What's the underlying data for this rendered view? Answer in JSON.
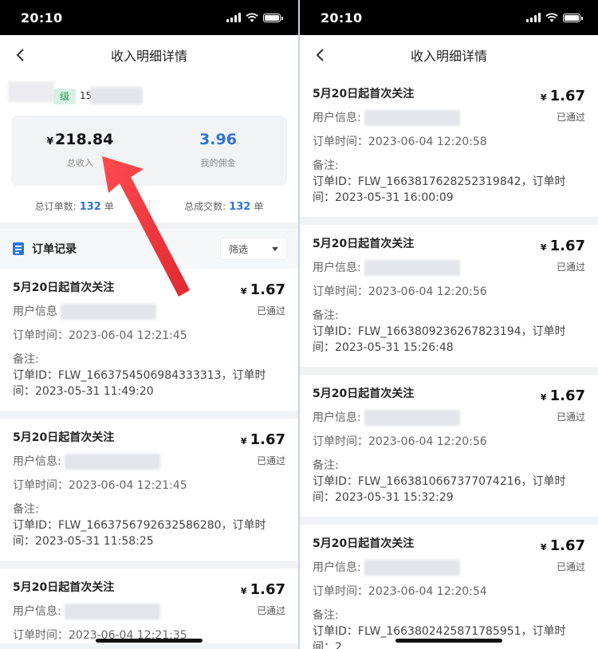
{
  "left": {
    "status_time": "20:10",
    "nav_title": "收入明细详情",
    "profile": {
      "level": "级",
      "uid_prefix": "15"
    },
    "summary": {
      "income_currency": "¥",
      "income_value": "218.84",
      "income_label": "总收入",
      "commission_value": "3.96",
      "commission_label": "我的佣金"
    },
    "counts": {
      "orders_label": "总订单数:",
      "orders_value": "132",
      "orders_unit": "单",
      "deals_label": "总成交数:",
      "deals_value": "132",
      "deals_unit": "单"
    },
    "section": {
      "title": "订单记录",
      "filter": "筛选"
    },
    "cards": [
      {
        "title": "5月20日起首次关注",
        "currency": "¥",
        "amount": "1.67",
        "status": "已通过",
        "user_label": "用户信息",
        "time": "订单时间：2023-06-04 12:21:45",
        "remark_label": "备注:",
        "remark": "订单ID：FLW_1663754506984333313，订单时间：2023-05-31 11:49:20"
      },
      {
        "title": "5月20日起首次关注",
        "currency": "¥",
        "amount": "1.67",
        "status": "已通过",
        "user_label": "用户信息:",
        "time": "订单时间：2023-06-04 12:21:45",
        "remark_label": "备注:",
        "remark": "订单ID：FLW_1663756792632586280，订单时间：2023-05-31 11:58:25"
      },
      {
        "title": "5月20日起首次关注",
        "currency": "¥",
        "amount": "1.67",
        "status": "已通过",
        "user_label": "用户信息:",
        "time": "订单时间：2023-06-04 12:21:35",
        "remark_label": "",
        "remark": ""
      }
    ]
  },
  "right": {
    "status_time": "20:10",
    "nav_title": "收入明细详情",
    "cards": [
      {
        "title": "5月20日起首次关注",
        "currency": "¥",
        "amount": "1.67",
        "status": "已通过",
        "user_label": "用户信息:",
        "time": "订单时间：2023-06-04 12:20:58",
        "remark_label": "备注:",
        "remark": "订单ID：FLW_1663817628252319842，订单时间：2023-05-31 16:00:09"
      },
      {
        "title": "5月20日起首次关注",
        "currency": "¥",
        "amount": "1.67",
        "status": "已通过",
        "user_label": "用户信息:",
        "time": "订单时间：2023-06-04 12:20:56",
        "remark_label": "备注:",
        "remark": "订单ID：FLW_1663809236267823194，订单时间：2023-05-31 15:26:48"
      },
      {
        "title": "5月20日起首次关注",
        "currency": "¥",
        "amount": "1.67",
        "status": "已通过",
        "user_label": "用户信息:",
        "time": "订单时间：2023-06-04 12:20:56",
        "remark_label": "备注:",
        "remark": "订单ID：FLW_1663810667377074216，订单时间：2023-05-31 15:32:29"
      },
      {
        "title": "5月20日起首次关注",
        "currency": "¥",
        "amount": "1.67",
        "status": "已通过",
        "user_label": "用户信息:",
        "time": "订单时间：2023-06-04 12:20:54",
        "remark_label": "备注:",
        "remark": "订单ID：FLW_1663802425871785951，订单时间：2"
      }
    ]
  },
  "colors": {
    "accent_blue": "#2e74d9",
    "level_green": "#2a9c62",
    "arrow_red": "#e8323a"
  }
}
